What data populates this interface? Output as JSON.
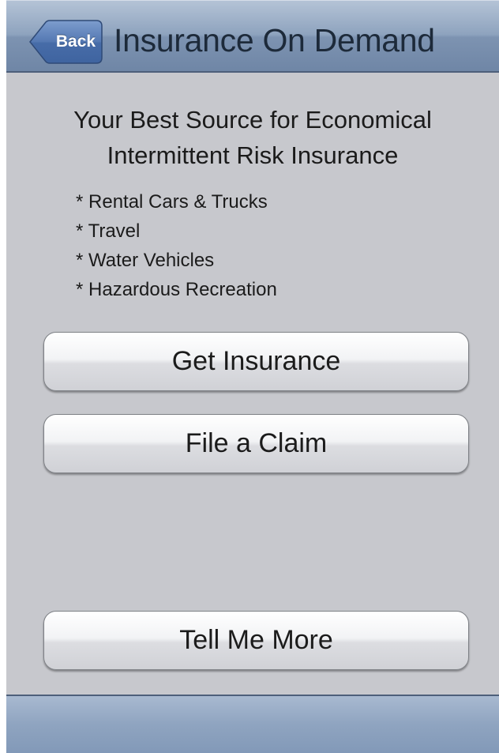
{
  "navbar": {
    "back_label": "Back",
    "title": "Insurance On Demand"
  },
  "headline": {
    "line1": "Your Best Source for Economical",
    "line2": "Intermittent Risk Insurance"
  },
  "features": [
    "* Rental Cars & Trucks",
    "* Travel",
    "* Water Vehicles",
    "* Hazardous Recreation"
  ],
  "buttons": {
    "get_insurance": "Get Insurance",
    "file_claim": "File a Claim",
    "tell_me_more": "Tell Me More"
  },
  "colors": {
    "navbar": "#8ea3be",
    "background": "#c7c8cd",
    "back_button": "#5d80b6"
  }
}
